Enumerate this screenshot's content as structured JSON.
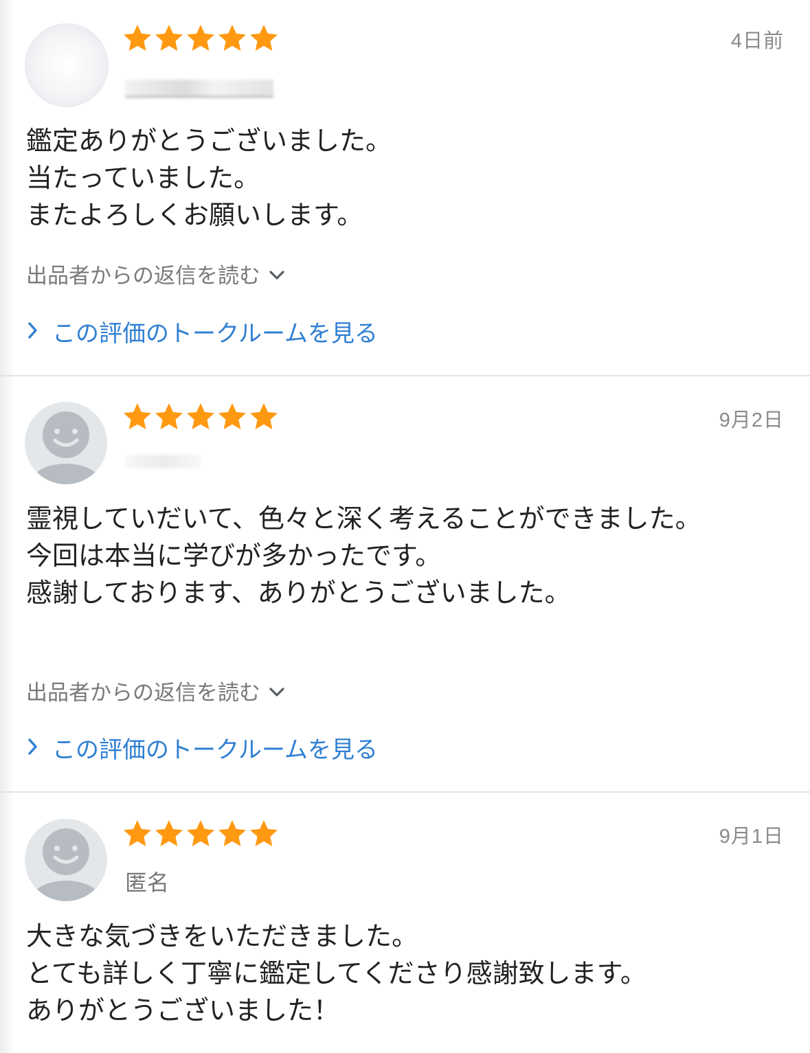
{
  "colors": {
    "star": "#FF9911",
    "link": "#2F7FD2",
    "date": "#8A8A8A",
    "avatar_bg": "#E4E7EA",
    "avatar_fg": "#B6BCC2"
  },
  "icons": {
    "star": "star-icon",
    "reply_toggle": "chevron-down-icon",
    "talk_link": "chevron-right-icon",
    "avatar": "default-avatar-icon"
  },
  "reviews": [
    {
      "rating": 5,
      "date": "4日前",
      "reviewer": "",
      "comment": [
        "鑑定ありがとうございました。",
        "当たっていました。",
        "またよろしくお願いします。"
      ],
      "reply_label": "出品者からの返信を読む",
      "talk_label": "この評価のトークルームを見る"
    },
    {
      "rating": 5,
      "date": "9月2日",
      "reviewer": "",
      "comment": [
        "霊視していだいて、色々と深く考えることができました。",
        "今回は本当に学びが多かったです。",
        "感謝しております、ありがとうございました。"
      ],
      "reply_label": "出品者からの返信を読む",
      "talk_label": "この評価のトークルームを見る"
    },
    {
      "rating": 5,
      "date": "9月1日",
      "reviewer": "匿名",
      "comment": [
        "大きな気づきをいただきました。",
        "とても詳しく丁寧に鑑定してくださり感謝致します。",
        "ありがとうございました！"
      ]
    }
  ]
}
